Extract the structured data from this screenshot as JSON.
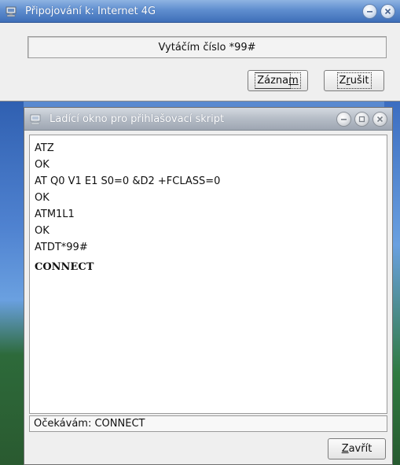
{
  "connect_dialog": {
    "title": "Připojování k: Internet 4G",
    "status_text": "Vytáčím číslo *99#",
    "log_button_pre": "Zázna",
    "log_button_mnemonic": "m",
    "cancel_button_pre": "Z",
    "cancel_button_mnemonic": "r",
    "cancel_button_post": "ušit"
  },
  "debug_window": {
    "title": "Ladící okno pro přihlašovací skript",
    "log_lines": [
      "ATZ",
      "OK",
      "AT Q0 V1 E1 S0=0 &D2 +FCLASS=0",
      "OK",
      "ATM1L1",
      "OK",
      "ATDT*99#",
      "CONNECT"
    ],
    "status": "Očekávám: CONNECT",
    "close_button_mnemonic": "Z",
    "close_button_post": "avřít"
  },
  "icons": {
    "app": "network-dialup-icon",
    "minimize": "minimize-icon",
    "maximize": "maximize-icon",
    "close": "close-icon"
  }
}
